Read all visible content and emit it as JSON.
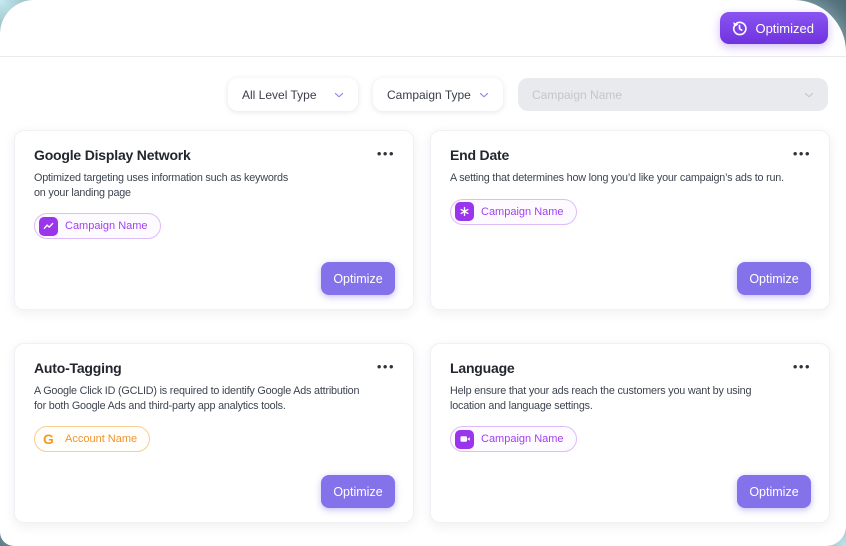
{
  "theme": {
    "backdrop": "#4C6873",
    "accent_gradient_start": "#8A55F2",
    "accent_gradient_end": "#6F32DE",
    "optimize_button": "#8372EA",
    "badge_purple_icon": "#9B35EC",
    "badge_purple_text": "#A341F2",
    "badge_orange_text": "#F0952E",
    "divider": "#E9EAEE"
  },
  "topbar": {
    "optimized_button_label": "Optimized"
  },
  "filters": {
    "level_type_value": "All Level Type",
    "campaign_type_value": "Campaign Type",
    "campaign_name_placeholder": "Campaign Name"
  },
  "cards": [
    {
      "title": "Google Display Network",
      "description": "Optimized targeting uses information such as keywords\non your landing page",
      "tag_label": "Campaign Name",
      "tag_icon": "line-chart-icon",
      "optimize_label": "Optimize"
    },
    {
      "title": "End Date",
      "description": "A setting that determines how long you’d like your campaign’s ads to run.",
      "tag_label": "Campaign Name",
      "tag_icon": "asterisk-icon",
      "optimize_label": "Optimize"
    },
    {
      "title": "Auto-Tagging",
      "description": "A Google Click ID (GCLID) is required to identify Google Ads attribution\nfor both Google Ads and third-party app analytics tools.",
      "tag_label": "Account Name",
      "tag_icon": "google-g-icon",
      "optimize_label": "Optimize"
    },
    {
      "title": "Language",
      "description": "Help ensure that your ads reach the customers you want by using\nlocation and language settings.",
      "tag_label": "Campaign Name",
      "tag_icon": "video-camera-icon",
      "optimize_label": "Optimize"
    }
  ]
}
